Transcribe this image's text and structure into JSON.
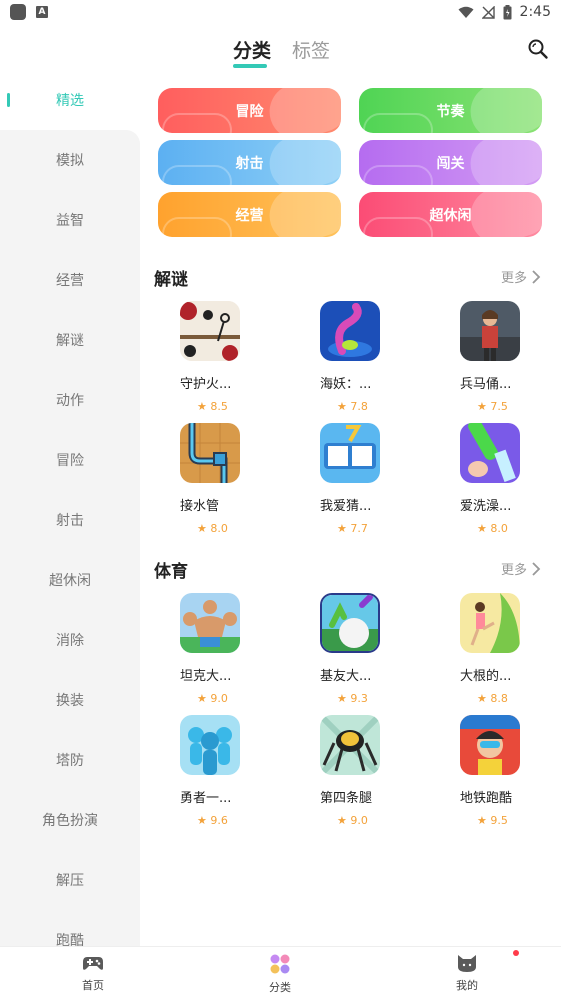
{
  "status_bar": {
    "time": "2:45"
  },
  "header": {
    "tab_active": "分类",
    "tab_inactive": "标签"
  },
  "sidebar": {
    "items": [
      "精选",
      "模拟",
      "益智",
      "经营",
      "解谜",
      "动作",
      "冒险",
      "射击",
      "超休闲",
      "消除",
      "换装",
      "塔防",
      "角色扮演",
      "解压",
      "跑酷"
    ],
    "active_index": 0
  },
  "categories": [
    {
      "label": "冒险",
      "color": "#ff6a64"
    },
    {
      "label": "节奏",
      "color": "#63d85e"
    },
    {
      "label": "射击",
      "color": "#64b6f2"
    },
    {
      "label": "闯关",
      "color": "#c07ef0"
    },
    {
      "label": "经营",
      "color": "#ffad3a"
    },
    {
      "label": "超休闲",
      "color": "#fb5d7f"
    }
  ],
  "sections": [
    {
      "title": "解谜",
      "more": "更多",
      "games": [
        {
          "name": "守护火...",
          "score": "8.5",
          "icon": "stickman-icon"
        },
        {
          "name": "海妖：...",
          "score": "7.8",
          "icon": "kraken-icon"
        },
        {
          "name": "兵马俑...",
          "score": "7.5",
          "icon": "soldier-icon"
        },
        {
          "name": "接水管",
          "score": "8.0",
          "icon": "pipes-icon"
        },
        {
          "name": "我爱猜...",
          "score": "7.7",
          "icon": "word-puzzle-icon"
        },
        {
          "name": "爱洗澡...",
          "score": "8.0",
          "icon": "washing-icon"
        }
      ]
    },
    {
      "title": "体育",
      "more": "更多",
      "games": [
        {
          "name": "坦克大...",
          "score": "9.0",
          "icon": "muscle-man-icon"
        },
        {
          "name": "基友大...",
          "score": "9.3",
          "icon": "snowball-icon"
        },
        {
          "name": "大根的...",
          "score": "8.8",
          "icon": "kicker-icon"
        },
        {
          "name": "勇者一...",
          "score": "9.6",
          "icon": "crowd-icon"
        },
        {
          "name": "第四条腿",
          "score": "9.0",
          "icon": "spider-bot-icon"
        },
        {
          "name": "地铁跑酷",
          "score": "9.5",
          "icon": "subway-surfer-icon"
        }
      ]
    }
  ],
  "score_star": "★",
  "bottom_nav": [
    {
      "label": "首页",
      "icon": "gamepad-icon"
    },
    {
      "label": "分类",
      "icon": "category-icon"
    },
    {
      "label": "我的",
      "icon": "cat-face-icon"
    }
  ],
  "accent_color": "#33c9b6"
}
